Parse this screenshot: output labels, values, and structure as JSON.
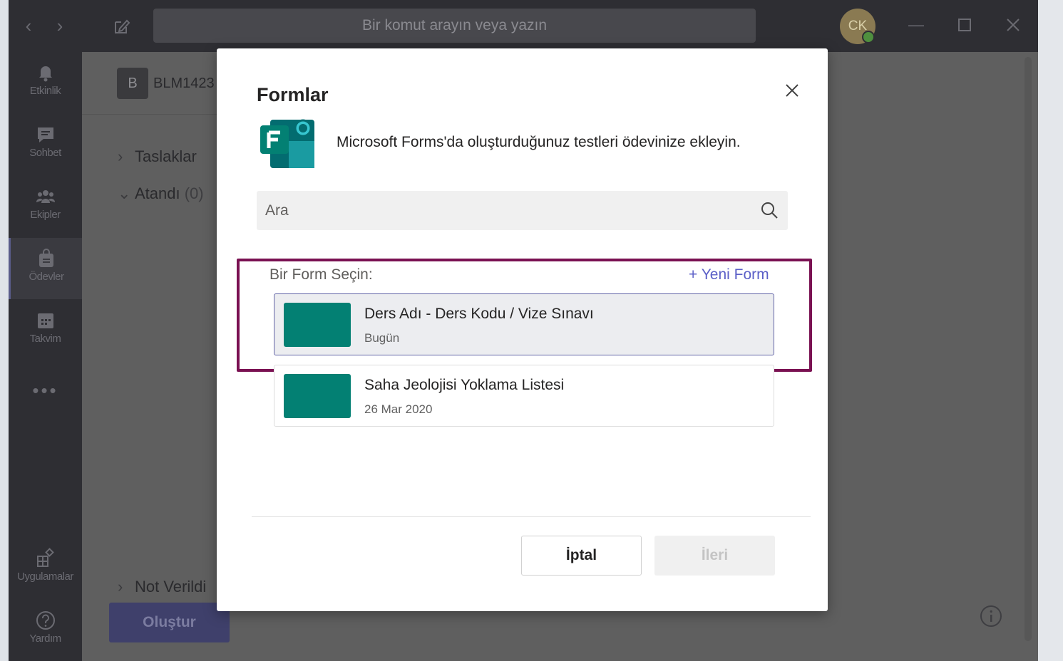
{
  "titlebar": {
    "search_placeholder": "Bir komut arayın veya yazın",
    "avatar_initials": "CK"
  },
  "rail": {
    "items": [
      {
        "label": "Etkinlik",
        "icon": "bell-icon"
      },
      {
        "label": "Sohbet",
        "icon": "chat-icon"
      },
      {
        "label": "Ekipler",
        "icon": "teams-icon"
      },
      {
        "label": "Ödevler",
        "icon": "assignments-icon",
        "active": true
      },
      {
        "label": "Takvim",
        "icon": "calendar-icon"
      },
      {
        "label": "Uygulamalar",
        "icon": "apps-icon"
      },
      {
        "label": "Yardım",
        "icon": "help-icon"
      }
    ],
    "more": "•••"
  },
  "panel": {
    "team_initial": "B",
    "team_name": "BLM1423",
    "drafts": "Taslaklar",
    "assigned": "Atandı",
    "assigned_count": "(0)",
    "graded": "Not Verildi",
    "create_button": "Oluştur"
  },
  "dialog": {
    "title": "Formlar",
    "description": "Microsoft Forms'da oluşturduğunuz testleri ödevinize ekleyin.",
    "search_placeholder": "Ara",
    "pick_label": "Bir Form Seçin:",
    "new_form": "+ Yeni Form",
    "forms": [
      {
        "name": "Ders Adı - Ders Kodu / Vize Sınavı",
        "date": "Bugün",
        "selected": true
      },
      {
        "name": "Saha Jeolojisi Yoklama Listesi",
        "date": "26 Mar 2020",
        "selected": false
      }
    ],
    "cancel_button": "İptal",
    "next_button": "İleri"
  },
  "colors": {
    "accent": "#6264a7",
    "forms_green": "#038073",
    "highlight": "#7a1152"
  }
}
